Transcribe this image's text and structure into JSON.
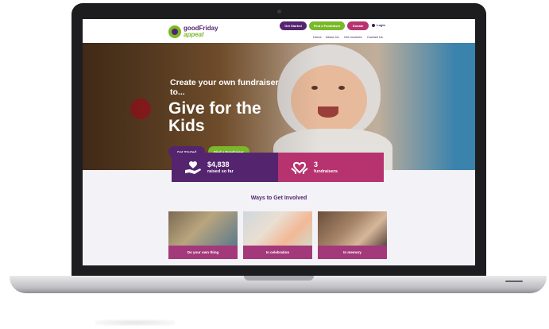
{
  "header": {
    "logo_line1": "goodFriday",
    "logo_line2": "appeal",
    "buttons": {
      "get_started": "Get Started",
      "find_fundraiser": "Find a Fundraiser",
      "donate": "Donate"
    },
    "login": "Login",
    "nav": [
      "Home",
      "About Us",
      "Get Involved",
      "Contact Us"
    ]
  },
  "hero": {
    "subtitle": "Create your own fundraiser to...",
    "title": "Give for the Kids",
    "buttons": {
      "get_started": "Get Started",
      "find_fundraiser": "Find a Fundraiser"
    }
  },
  "stats": {
    "raised_value": "$4,838",
    "raised_label": "raised so far",
    "fundraisers_value": "3",
    "fundraisers_label": "fundraisers"
  },
  "ways": {
    "title": "Ways to Get Involved",
    "cards": [
      {
        "label": "Do your own thing"
      },
      {
        "label": "In celebration"
      },
      {
        "label": "In memory"
      }
    ]
  },
  "icons": {
    "raised": "hand-heart-icon",
    "fundraisers": "hands-heart-icon",
    "login": "user-icon"
  },
  "colors": {
    "purple": "#55246f",
    "green": "#7ab829",
    "pink": "#b7336f",
    "card_caption": "#a3397a"
  }
}
